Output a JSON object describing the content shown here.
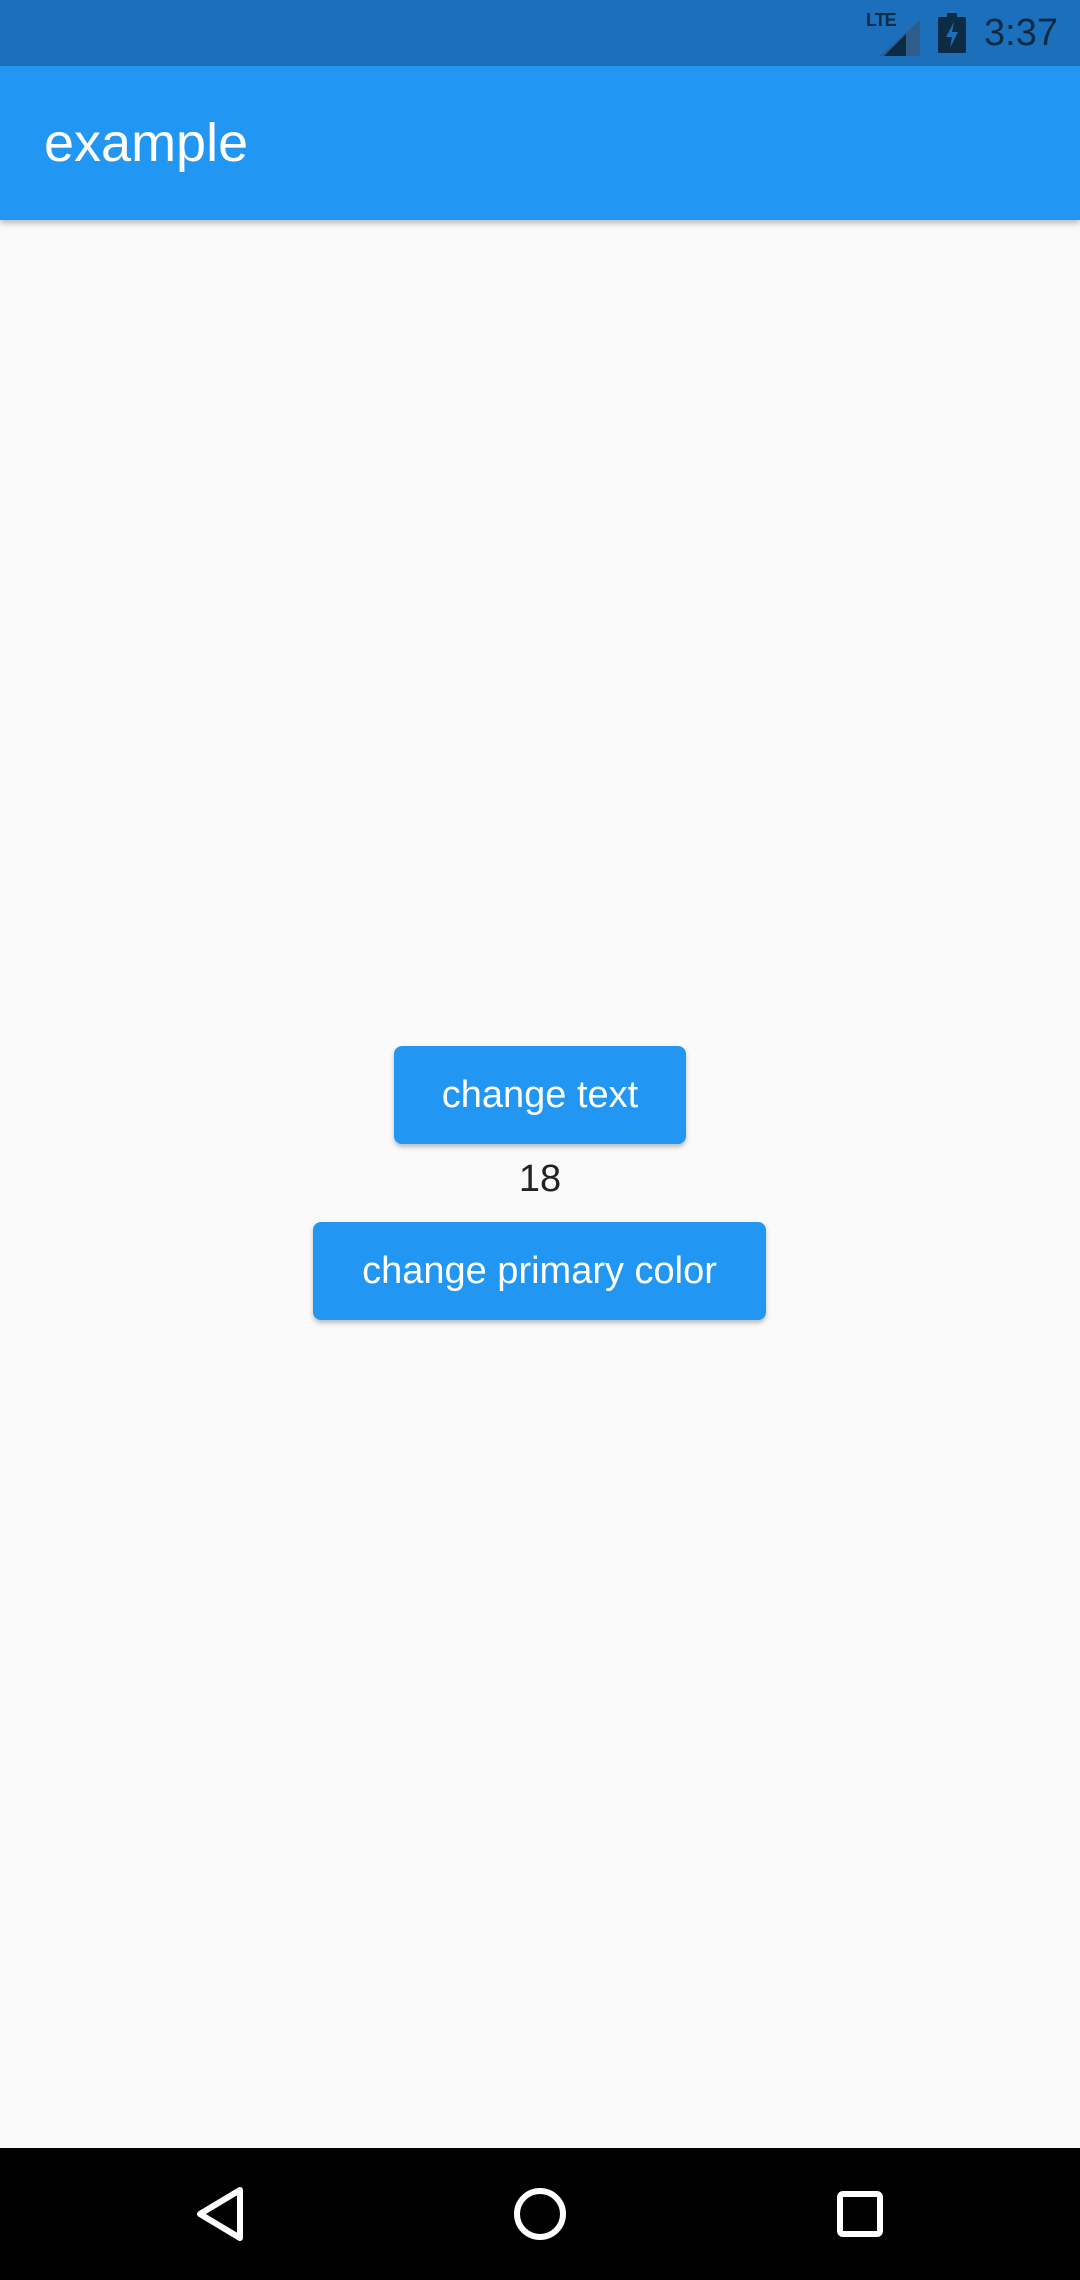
{
  "status_bar": {
    "network_label": "LTE",
    "time": "3:37",
    "signal_icon": "cell-signal-icon",
    "battery_icon": "battery-charging-icon",
    "background_color": "#1C70BB"
  },
  "app_bar": {
    "title": "example",
    "background_color": "#2296F3"
  },
  "main": {
    "change_text_label": "change text",
    "counter_value": "18",
    "change_color_label": "change primary color",
    "button_color": "#2296F3"
  },
  "nav_bar": {
    "back_icon": "back-triangle-icon",
    "home_icon": "home-circle-icon",
    "recents_icon": "recents-square-icon"
  }
}
